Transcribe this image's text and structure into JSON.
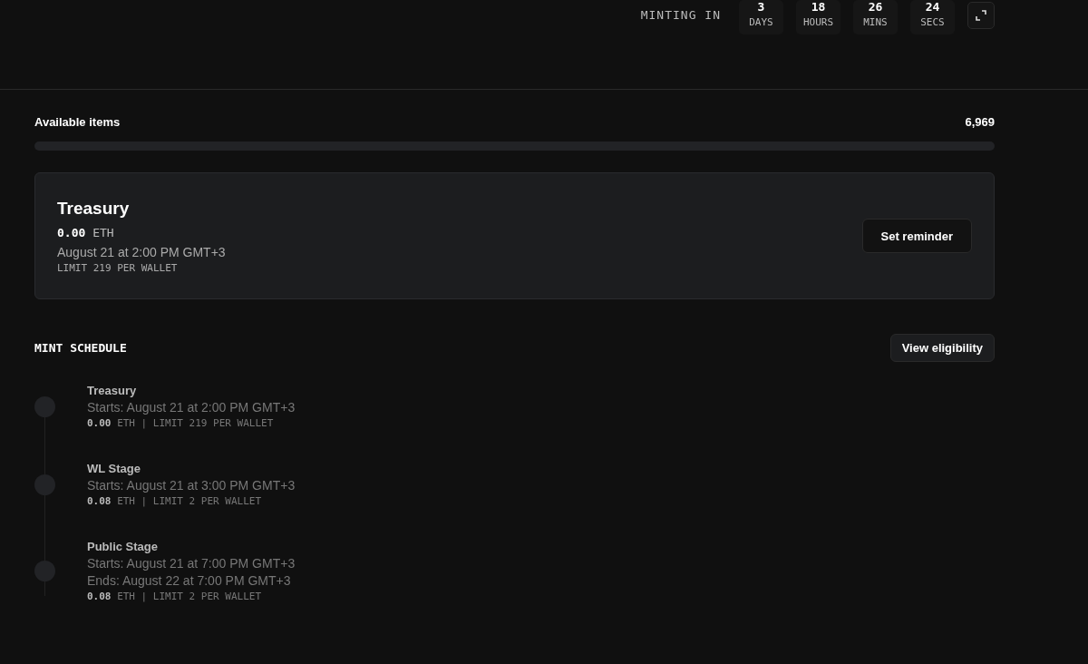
{
  "countdown": {
    "label": "MINTING IN",
    "units": [
      {
        "value": "3",
        "unit": "DAYS"
      },
      {
        "value": "18",
        "unit": "HOURS"
      },
      {
        "value": "26",
        "unit": "MINS"
      },
      {
        "value": "24",
        "unit": "SECS"
      }
    ]
  },
  "supply": {
    "label": "Available items",
    "count": "6,969",
    "level": 0
  },
  "current_stage": {
    "name": "Treasury",
    "price": "0.00",
    "currency": "ETH",
    "date": "August 21 at 2:00 PM GMT+3",
    "limit": "LIMIT 219 PER WALLET",
    "button": "Set reminder"
  },
  "schedule": {
    "title": "MINT SCHEDULE",
    "button": "View eligibility",
    "stages": [
      {
        "name": "Treasury",
        "lines": [
          "Starts: August 21 at 2:00 PM GMT+3"
        ],
        "price": "0.00",
        "rest": "ETH | LIMIT 219 PER WALLET"
      },
      {
        "name": "WL Stage",
        "lines": [
          "Starts: August 21 at 3:00 PM GMT+3"
        ],
        "price": "0.08",
        "rest": "ETH | LIMIT 2 PER WALLET"
      },
      {
        "name": "Public Stage",
        "lines": [
          "Starts: August 21 at 7:00 PM GMT+3",
          "Ends: August 22 at 7:00 PM GMT+3"
        ],
        "price": "0.08",
        "rest": "ETH | LIMIT 2 PER WALLET"
      }
    ]
  }
}
